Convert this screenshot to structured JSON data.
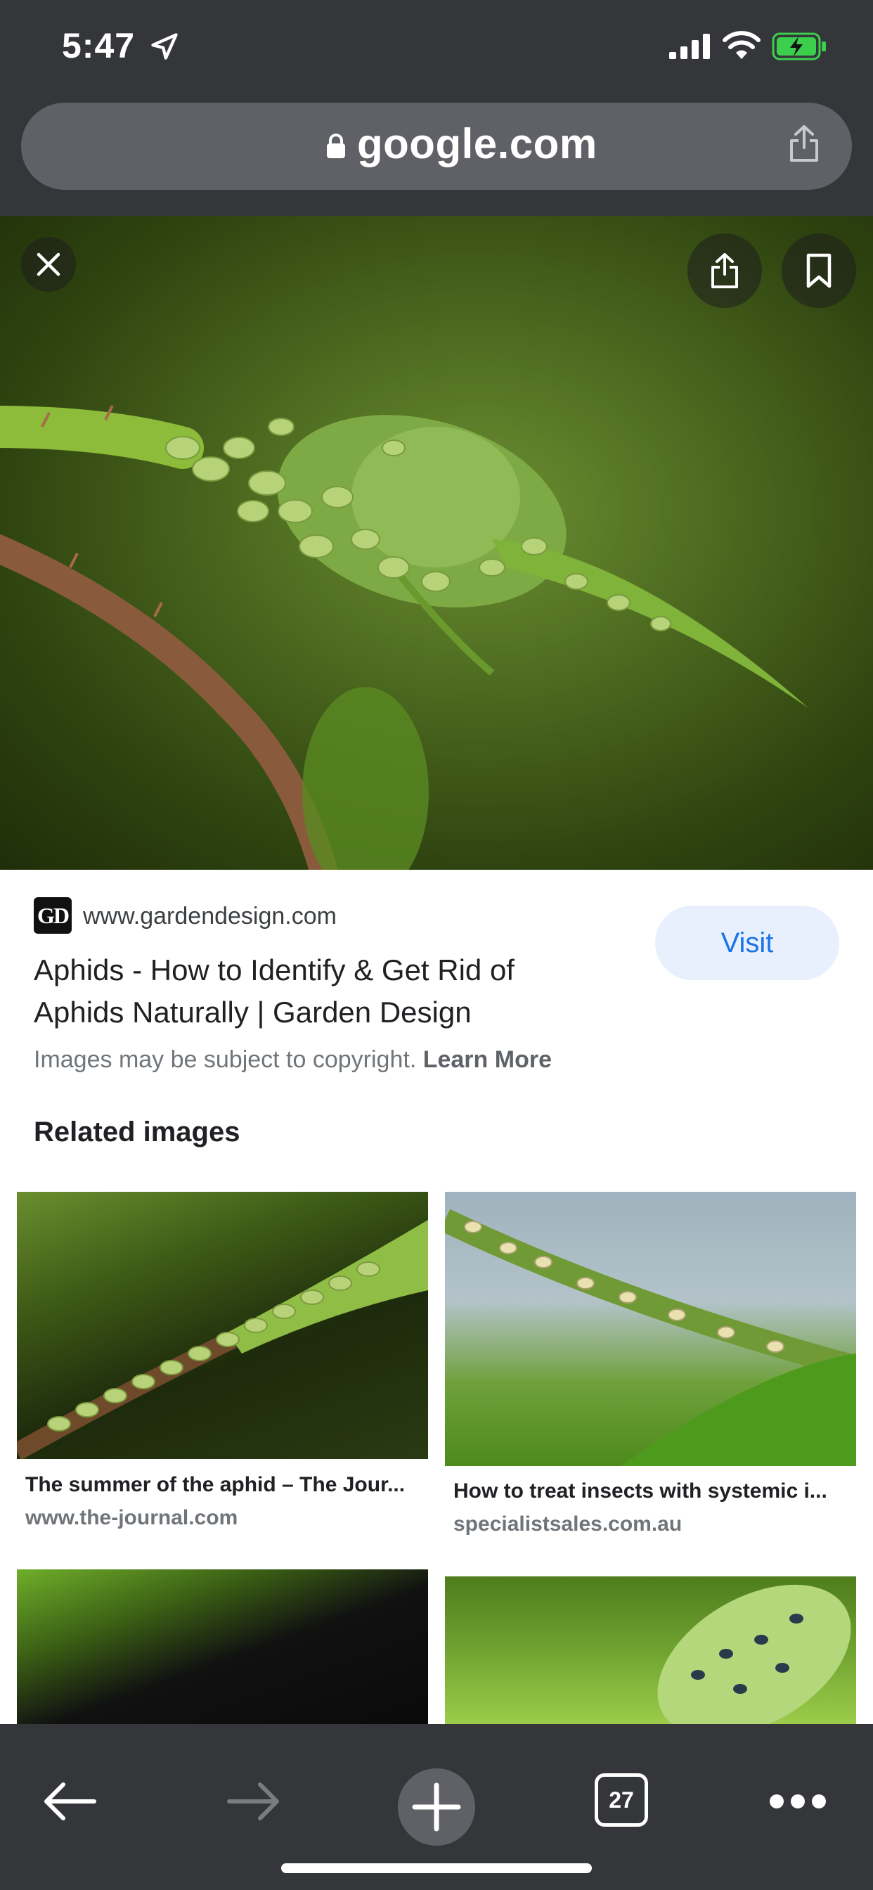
{
  "status_bar": {
    "time": "5:47"
  },
  "address_bar": {
    "url": "google.com"
  },
  "result": {
    "favicon_text": "GD",
    "domain": "www.gardendesign.com",
    "title": "Aphids - How to Identify & Get Rid of Aphids Naturally | Garden Design",
    "copyright_text": "Images may be subject to copyright.",
    "learn_more": "Learn More",
    "visit_label": "Visit"
  },
  "related": {
    "heading": "Related images",
    "items": [
      {
        "title": "The summer of the aphid – The Jour...",
        "source": "www.the-journal.com"
      },
      {
        "title": "How to treat insects with systemic i...",
        "source": "specialistsales.com.au"
      }
    ]
  },
  "toolbar": {
    "tab_count": "27"
  },
  "colors": {
    "chrome": "#35363a",
    "address_bar": "#5f6166",
    "visit_bg": "#e8f0fe",
    "visit_text": "#1a73e8"
  }
}
